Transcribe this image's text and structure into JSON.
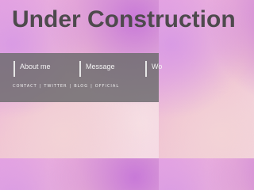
{
  "header": {
    "title": "Under Construction"
  },
  "nav": {
    "items": [
      {
        "label": "About me"
      },
      {
        "label": "Message"
      },
      {
        "label": "Wo"
      }
    ],
    "sublinks": [
      {
        "label": "CONTACT"
      },
      {
        "label": "TWITTER"
      },
      {
        "label": "BLOG"
      },
      {
        "label": "OFFICIAL"
      }
    ],
    "separator": "|"
  }
}
